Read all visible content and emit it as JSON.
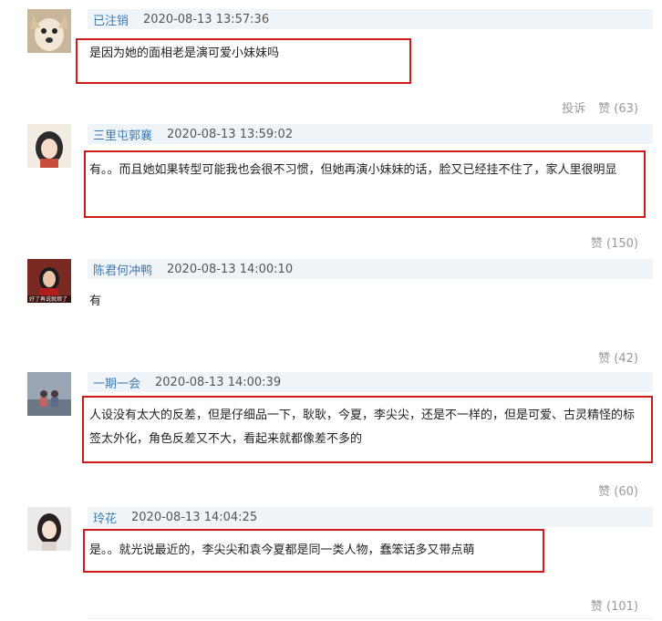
{
  "comments": [
    {
      "author": "已注销",
      "time": "2020-08-13 13:57:36",
      "text": "是因为她的面相老是演可爱小妹妹吗",
      "report": "投诉",
      "like": "赞 (63)"
    },
    {
      "author": "三里屯郭襄",
      "time": "2020-08-13 13:59:02",
      "text": "有。。而且她如果转型可能我也会很不习惯，但她再演小妹妹的话，脸又已经挂不住了，家人里很明显",
      "like": "赞 (150)"
    },
    {
      "author": "陈君何冲鸭",
      "time": "2020-08-13 14:00:10",
      "text": "有",
      "like": "赞 (42)",
      "avatar_caption": "好了再说就烦了"
    },
    {
      "author": "一期一会",
      "time": "2020-08-13 14:00:39",
      "text": "人设没有太大的反差，但是仔细品一下，耿耿，今夏，李尖尖，还是不一样的，但是可爱、古灵精怪的标签太外化，角色反差又不大，看起来就都像差不多的",
      "like": "赞 (60)"
    },
    {
      "author": "玲花",
      "time": "2020-08-13 14:04:25",
      "text": "是。。就光说最近的，李尖尖和袁今夏都是同一类人物，蠢笨话多又带点萌",
      "like": "赞 (101)"
    }
  ],
  "colors": {
    "highlight": "#cc1b1b",
    "meta_bg": "#eef4f8",
    "author": "#3e7ab0"
  }
}
